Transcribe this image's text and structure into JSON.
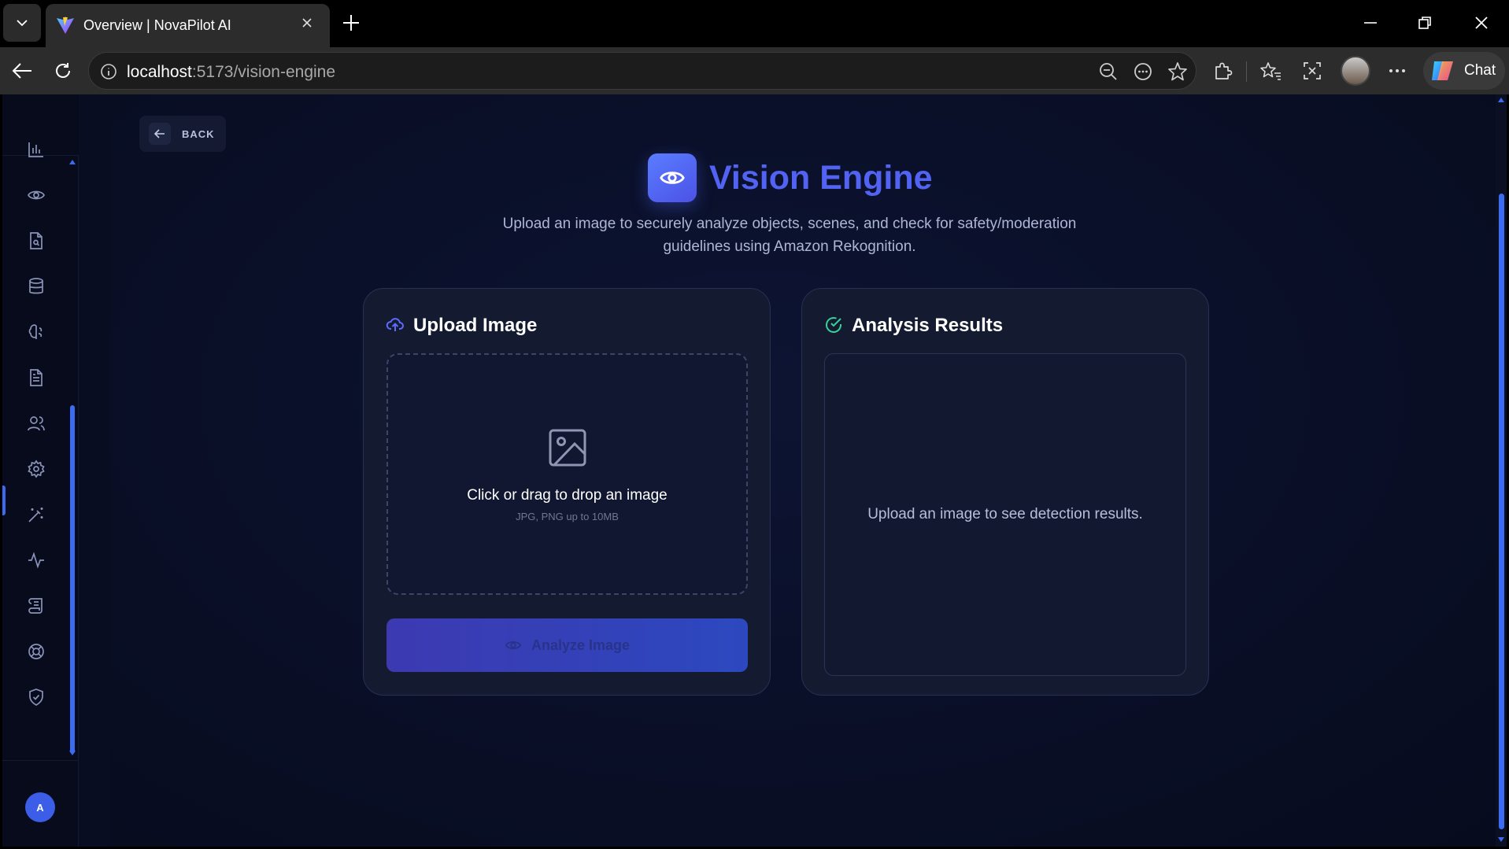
{
  "browser": {
    "tab_title": "Overview | NovaPilot AI",
    "url_host": "localhost",
    "url_path": ":5173/vision-engine",
    "chat_label": "Chat"
  },
  "sidebar": {
    "items": [
      {
        "name": "analytics",
        "icon": "bar-chart-icon"
      },
      {
        "name": "vision",
        "icon": "eye-icon"
      },
      {
        "name": "document-search",
        "icon": "file-search-icon"
      },
      {
        "name": "database",
        "icon": "database-icon"
      },
      {
        "name": "ai-brain",
        "icon": "brain-icon"
      },
      {
        "name": "documents",
        "icon": "file-text-icon"
      },
      {
        "name": "users",
        "icon": "users-icon"
      },
      {
        "name": "settings",
        "icon": "gear-icon"
      },
      {
        "name": "magic",
        "icon": "magic-wand-icon"
      },
      {
        "name": "activity",
        "icon": "activity-icon"
      },
      {
        "name": "scroll",
        "icon": "scroll-icon"
      },
      {
        "name": "support",
        "icon": "life-buoy-icon"
      },
      {
        "name": "security",
        "icon": "shield-icon"
      }
    ],
    "active_item": "settings",
    "avatar_initial": "A"
  },
  "back_button": {
    "label": "BACK"
  },
  "header": {
    "title": "Vision Engine",
    "subtitle": "Upload an image to securely analyze objects, scenes, and check for safety/moderation guidelines using Amazon Rekognition."
  },
  "upload_card": {
    "title": "Upload Image",
    "drop_text": "Click or drag to drop an image",
    "drop_hint": "JPG, PNG up to 10MB",
    "analyze_label": "Analyze Image"
  },
  "results_card": {
    "title": "Analysis Results",
    "empty_text": "Upload an image to see detection results."
  },
  "colors": {
    "accent": "#5262f2",
    "success": "#34d399",
    "background": "#0a1029"
  }
}
